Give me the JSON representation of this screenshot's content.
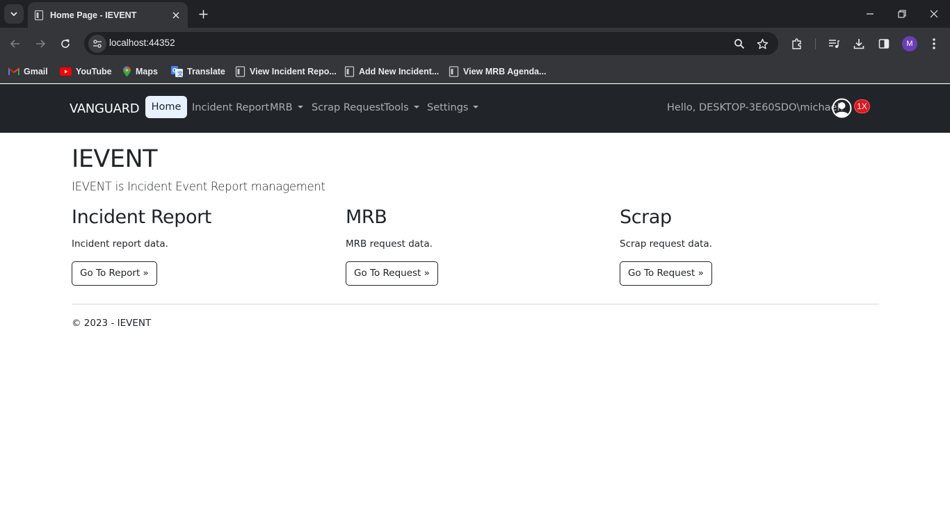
{
  "browser": {
    "tab_title": "Home Page - IEVENT",
    "url": "localhost:44352",
    "profile_initial": "M",
    "bookmarks": [
      {
        "label": "Gmail",
        "icon": "gmail-icon"
      },
      {
        "label": "YouTube",
        "icon": "youtube-icon"
      },
      {
        "label": "Maps",
        "icon": "maps-icon"
      },
      {
        "label": "Translate",
        "icon": "translate-icon"
      },
      {
        "label": "View Incident Repo...",
        "icon": "page-icon"
      },
      {
        "label": "Add New Incident...",
        "icon": "page-icon"
      },
      {
        "label": "View MRB Agenda...",
        "icon": "page-icon"
      }
    ]
  },
  "navbar": {
    "brand": "VANGUARD",
    "home": "Home",
    "incident_report": "Incident Report",
    "mrb": "MRB",
    "scrap_request": "Scrap Request",
    "tools": "Tools",
    "settings": "Settings",
    "greeting": "Hello, DESKTOP-3E60SDO\\michael!",
    "badge": "1X"
  },
  "main": {
    "title": "IEVENT",
    "lead": "IEVENT is Incident Event Report management",
    "columns": [
      {
        "heading": "Incident Report",
        "text": "Incident report data.",
        "button": "Go To Report »"
      },
      {
        "heading": "MRB",
        "text": "MRB request data.",
        "button": "Go To Request »"
      },
      {
        "heading": "Scrap",
        "text": "Scrap request data.",
        "button": "Go To Request »"
      }
    ]
  },
  "footer": {
    "text": "© 2023 - IEVENT"
  }
}
